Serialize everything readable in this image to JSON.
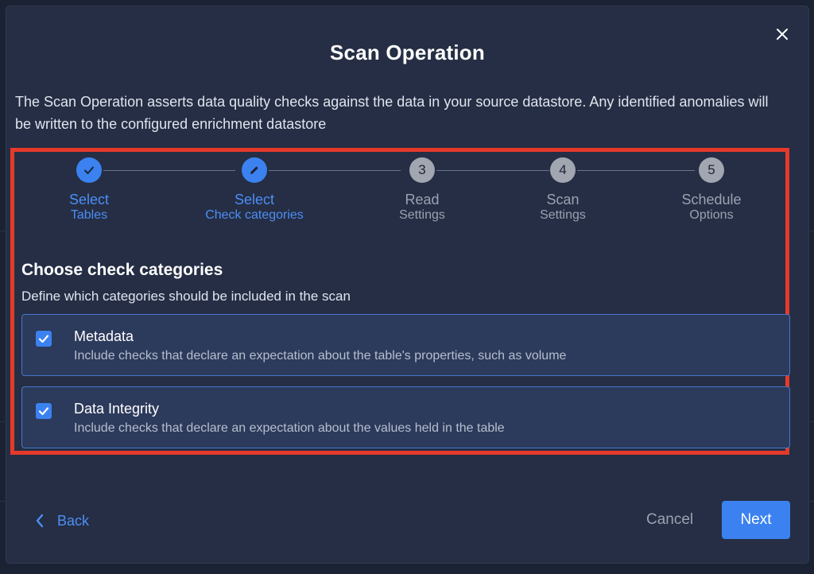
{
  "dialog": {
    "title": "Scan Operation",
    "description": "The Scan Operation asserts data quality checks against the data in your source datastore. Any identified anomalies will be written to the configured enrichment datastore",
    "close_icon": "close-icon"
  },
  "stepper": {
    "steps": [
      {
        "number": "",
        "label": "Select",
        "sub": "Tables",
        "state": "completed",
        "icon": "check-icon"
      },
      {
        "number": "",
        "label": "Select",
        "sub": "Check categories",
        "state": "current",
        "icon": "pencil-icon"
      },
      {
        "number": "3",
        "label": "Read",
        "sub": "Settings",
        "state": "pending"
      },
      {
        "number": "4",
        "label": "Scan",
        "sub": "Settings",
        "state": "pending"
      },
      {
        "number": "5",
        "label": "Schedule",
        "sub": "Options",
        "state": "pending"
      }
    ]
  },
  "section": {
    "title": "Choose check categories",
    "subtitle": "Define which categories should be included in the scan"
  },
  "options": [
    {
      "title": "Metadata",
      "description": "Include checks that declare an expectation about the table's properties, such as volume",
      "checked": true
    },
    {
      "title": "Data Integrity",
      "description": "Include checks that declare an expectation about the values held in the table",
      "checked": true
    }
  ],
  "footer": {
    "back_label": "Back",
    "cancel_label": "Cancel",
    "next_label": "Next"
  },
  "colors": {
    "accent": "#3b82f0",
    "highlight": "#e53a2b",
    "modal_bg": "#252e44"
  }
}
